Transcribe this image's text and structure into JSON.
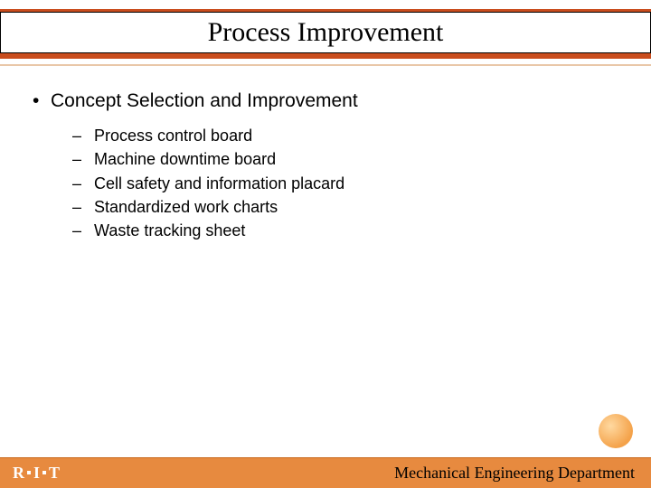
{
  "title": "Process Improvement",
  "main_bullet": "Concept Selection and Improvement",
  "sub_bullets": [
    "Process control board",
    "Machine downtime board",
    "Cell safety and information placard",
    "Standardized work charts",
    "Waste tracking sheet"
  ],
  "footer": {
    "left_r": "R",
    "left_i": "I",
    "left_t": "T",
    "right": "Mechanical Engineering Department"
  }
}
